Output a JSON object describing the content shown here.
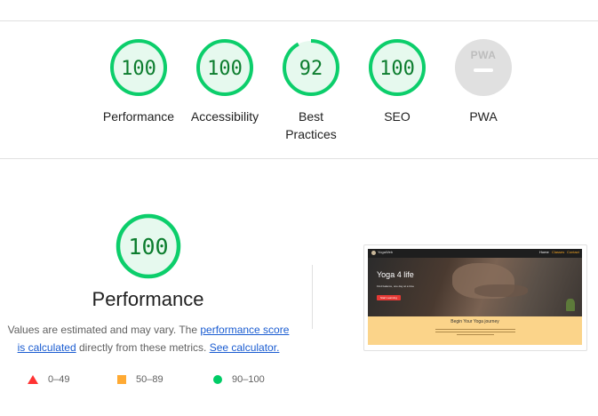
{
  "categories": [
    {
      "label": "Performance",
      "score": "100",
      "value": 100
    },
    {
      "label": "Accessibility",
      "score": "100",
      "value": 100
    },
    {
      "label": "Best Practices",
      "score": "92",
      "value": 92
    },
    {
      "label": "SEO",
      "score": "100",
      "value": 100
    },
    {
      "label": "PWA",
      "score": "",
      "value": null,
      "badge_text": "PWA"
    }
  ],
  "main": {
    "score": "100",
    "value": 100,
    "title": "Performance",
    "desc_text_1": "Values are estimated and may vary. The ",
    "desc_link_1": "performance score is calculated",
    "desc_text_2": " directly from these metrics. ",
    "desc_link_2": "See calculator."
  },
  "legend": [
    {
      "range": "0–49",
      "shape": "triangle",
      "color": "#ff3333"
    },
    {
      "range": "50–89",
      "shape": "square",
      "color": "#ffaa33"
    },
    {
      "range": "90–100",
      "shape": "circle",
      "color": "#00cc66"
    }
  ],
  "screenshot": {
    "brand": "YogaWeb",
    "nav_items": [
      "Home",
      "Classes",
      "Contact"
    ],
    "hero_title": "Yoga 4 life",
    "hero_sub": "Find balance, one day at a time",
    "hero_button": "Start Learning",
    "band_title": "Begin Your Yoga journey"
  },
  "colors": {
    "pass": "#0cce6b",
    "pass_fill": "#e6f9ee",
    "pass_text": "#0c7d2e",
    "pwa_grey": "#e0e0e0",
    "link": "#1a5cd1"
  }
}
